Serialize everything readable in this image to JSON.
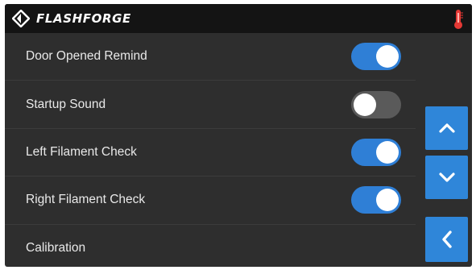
{
  "header": {
    "brand": "FLASHFORGE",
    "logo_icon": "flashforge-logo-icon",
    "status_icon": "thermometer-icon",
    "status_icon_color": "#e53935"
  },
  "settings": [
    {
      "label": "Door Opened Remind",
      "toggle": true
    },
    {
      "label": "Startup Sound",
      "toggle": false
    },
    {
      "label": "Left Filament Check",
      "toggle": true
    },
    {
      "label": "Right Filament Check",
      "toggle": true
    },
    {
      "label": "Calibration",
      "toggle": null
    }
  ],
  "nav": {
    "up_icon": "chevron-up-icon",
    "down_icon": "chevron-down-icon",
    "back_icon": "chevron-left-icon"
  },
  "colors": {
    "accent": "#2f86d9",
    "toggle_on": "#2f7fd6",
    "toggle_off": "#5a5a5a",
    "background": "#2e2e2e",
    "header": "#141414"
  }
}
